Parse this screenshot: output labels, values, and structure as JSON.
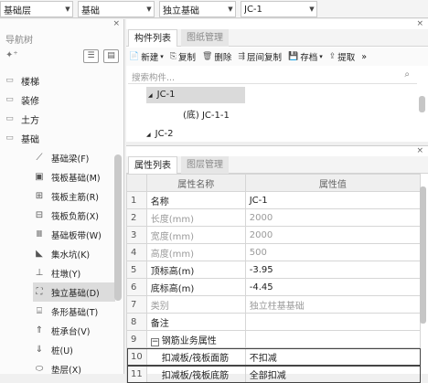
{
  "filters": [
    {
      "value": "基础层"
    },
    {
      "value": "基础"
    },
    {
      "value": "独立基础"
    },
    {
      "value": "JC-1"
    }
  ],
  "nav": {
    "title": "导航树",
    "categories": [
      {
        "label": "楼梯",
        "icon": "folder-icon"
      },
      {
        "label": "装修",
        "icon": "folder-icon"
      },
      {
        "label": "土方",
        "icon": "folder-icon"
      },
      {
        "label": "基础",
        "icon": "folder-open-icon"
      }
    ],
    "items": [
      {
        "label": "基础梁(F)",
        "icon": "beam-icon",
        "glyph": "⟋"
      },
      {
        "label": "筏板基础(M)",
        "icon": "raft-icon",
        "glyph": "▣"
      },
      {
        "label": "筏板主筋(R)",
        "icon": "raft-rebar-icon",
        "glyph": "⊞"
      },
      {
        "label": "筏板负筋(X)",
        "icon": "raft-neg-rebar-icon",
        "glyph": "⊟"
      },
      {
        "label": "基础板带(W)",
        "icon": "strip-icon",
        "glyph": "Ⅲ"
      },
      {
        "label": "集水坑(K)",
        "icon": "sump-icon",
        "glyph": "◣"
      },
      {
        "label": "柱墩(Y)",
        "icon": "pier-icon",
        "glyph": "⊥"
      },
      {
        "label": "独立基础(D)",
        "icon": "isolated-footing-icon",
        "glyph": "⛶",
        "selected": true
      },
      {
        "label": "条形基础(T)",
        "icon": "strip-footing-icon",
        "glyph": "⌸"
      },
      {
        "label": "桩承台(V)",
        "icon": "pile-cap-icon",
        "glyph": "⇑"
      },
      {
        "label": "桩(U)",
        "icon": "pile-icon",
        "glyph": "⇓"
      },
      {
        "label": "垫层(X)",
        "icon": "cushion-icon",
        "glyph": "⬭"
      }
    ]
  },
  "components": {
    "tabs": [
      {
        "label": "构件列表",
        "active": true
      },
      {
        "label": "图纸管理",
        "active": false
      }
    ],
    "toolbar": [
      {
        "label": "新建",
        "glyph": "📄",
        "name": "new",
        "dropdown": true
      },
      {
        "label": "复制",
        "glyph": "⎘",
        "name": "copy"
      },
      {
        "label": "删除",
        "glyph": "🗑",
        "name": "delete"
      },
      {
        "label": "层间复制",
        "glyph": "⇶",
        "name": "layer-copy"
      },
      {
        "label": "存档",
        "glyph": "💾",
        "name": "archive",
        "dropdown": true
      },
      {
        "label": "提取",
        "glyph": "⇪",
        "name": "extract"
      }
    ],
    "more": "»",
    "search_placeholder": "搜索构件...",
    "tree": [
      {
        "label": "JC-1",
        "toggle": "◢",
        "level": 0,
        "selected": true
      },
      {
        "label": "(底) JC-1-1",
        "toggle": "",
        "level": 1
      },
      {
        "label": "JC-2",
        "toggle": "◢",
        "level": 0
      }
    ]
  },
  "properties": {
    "tabs": [
      {
        "label": "属性列表",
        "active": true
      },
      {
        "label": "图层管理",
        "active": false
      }
    ],
    "headers": [
      "属性名称",
      "属性值"
    ],
    "rows": [
      {
        "num": "1",
        "name": "名称",
        "value": "JC-1",
        "dim": false
      },
      {
        "num": "2",
        "name": "长度(mm)",
        "value": "2000",
        "dim": true
      },
      {
        "num": "3",
        "name": "宽度(mm)",
        "value": "2000",
        "dim": true
      },
      {
        "num": "4",
        "name": "高度(mm)",
        "value": "500",
        "dim": true
      },
      {
        "num": "5",
        "name": "顶标高(m)",
        "value": "-3.95",
        "dim": false
      },
      {
        "num": "6",
        "name": "底标高(m)",
        "value": "-4.45",
        "dim": false
      },
      {
        "num": "7",
        "name": "类别",
        "value": "独立柱基基础",
        "dim": true
      },
      {
        "num": "8",
        "name": "备注",
        "value": "",
        "dim": false
      },
      {
        "num": "9",
        "name": "钢筋业务属性",
        "value": "",
        "dim": false,
        "group": true
      },
      {
        "num": "10",
        "name": "扣减板/筏板面筋",
        "value": "不扣减",
        "dim": false,
        "highlight": true,
        "indent": true
      },
      {
        "num": "11",
        "name": "扣减板/筏板底筋",
        "value": "全部扣减",
        "dim": false,
        "highlight": true,
        "indent": true
      }
    ]
  }
}
